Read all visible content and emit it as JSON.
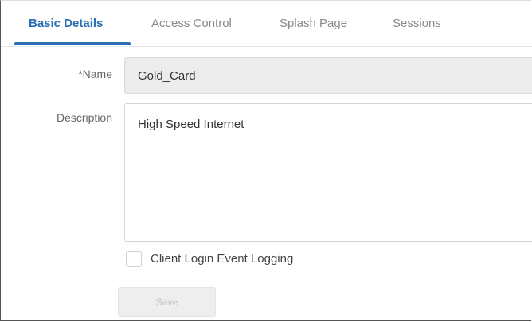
{
  "tabs": [
    {
      "label": "Basic Details",
      "active": true
    },
    {
      "label": "Access Control",
      "active": false
    },
    {
      "label": "Splash Page",
      "active": false
    },
    {
      "label": "Sessions",
      "active": false
    }
  ],
  "form": {
    "name_label": "*Name",
    "name_value": "Gold_Card",
    "description_label": "Description",
    "description_value": "High Speed Internet",
    "logging_label": "Client Login Event Logging",
    "logging_checked": false,
    "save_label": "Save",
    "save_disabled": true
  },
  "colors": {
    "accent": "#2a6fb5",
    "inactive_tab": "#8a8a8a",
    "readonly_field_bg": "#ececec"
  }
}
